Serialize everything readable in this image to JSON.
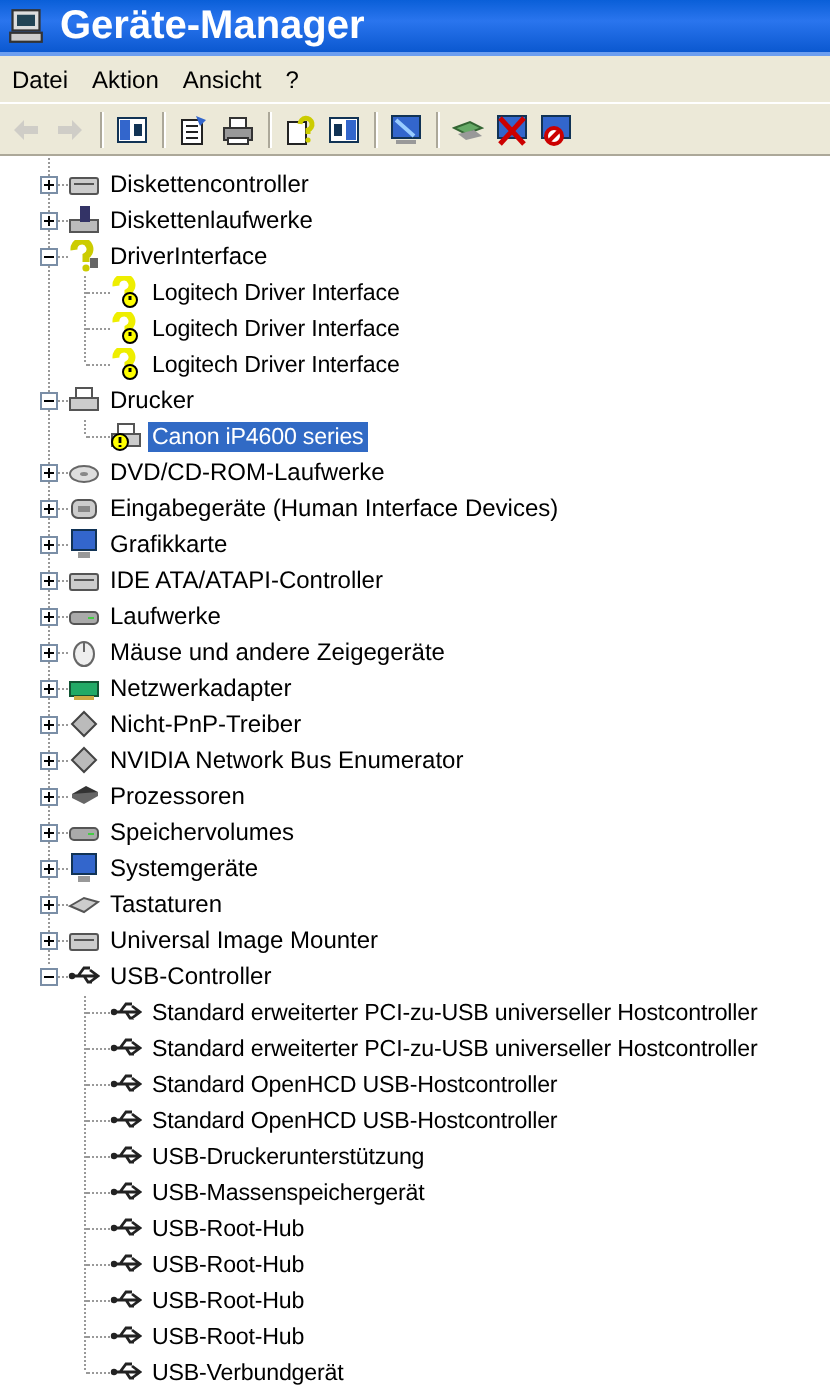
{
  "window": {
    "title": "Geräte-Manager"
  },
  "menu": [
    "Datei",
    "Aktion",
    "Ansicht",
    "?"
  ],
  "toolbar": [
    {
      "kind": "back",
      "disabled": true
    },
    {
      "kind": "forward",
      "disabled": true
    },
    {
      "kind": "sep"
    },
    {
      "kind": "tree-toggle",
      "disabled": false
    },
    {
      "kind": "sep"
    },
    {
      "kind": "properties",
      "disabled": false
    },
    {
      "kind": "print",
      "disabled": false
    },
    {
      "kind": "sep"
    },
    {
      "kind": "help",
      "disabled": false
    },
    {
      "kind": "pane-toggle",
      "disabled": false
    },
    {
      "kind": "sep"
    },
    {
      "kind": "scan",
      "disabled": false
    },
    {
      "kind": "sep"
    },
    {
      "kind": "update",
      "disabled": false
    },
    {
      "kind": "uninstall",
      "disabled": false
    },
    {
      "kind": "disable",
      "disabled": false
    }
  ],
  "tree": [
    {
      "label": "Diskettencontroller",
      "kind": "drive",
      "expanded": false,
      "selected": false
    },
    {
      "label": "Diskettenlaufwerke",
      "kind": "floppy",
      "expanded": false,
      "selected": false
    },
    {
      "label": "DriverInterface",
      "kind": "unknown",
      "expanded": true,
      "selected": false,
      "children": [
        {
          "label": "Logitech Driver Interface",
          "kind": "problem",
          "selected": false
        },
        {
          "label": "Logitech Driver Interface",
          "kind": "problem",
          "selected": false
        },
        {
          "label": "Logitech Driver Interface",
          "kind": "problem",
          "selected": false
        }
      ]
    },
    {
      "label": "Drucker",
      "kind": "printer",
      "expanded": true,
      "selected": false,
      "children": [
        {
          "label": "Canon iP4600 series",
          "kind": "printer-problem",
          "selected": true
        }
      ]
    },
    {
      "label": "DVD/CD-ROM-Laufwerke",
      "kind": "disc",
      "expanded": false,
      "selected": false
    },
    {
      "label": "Eingabegeräte (Human Interface Devices)",
      "kind": "hid",
      "expanded": false,
      "selected": false
    },
    {
      "label": "Grafikkarte",
      "kind": "display",
      "expanded": false,
      "selected": false
    },
    {
      "label": "IDE ATA/ATAPI-Controller",
      "kind": "drive",
      "expanded": false,
      "selected": false
    },
    {
      "label": "Laufwerke",
      "kind": "disk",
      "expanded": false,
      "selected": false
    },
    {
      "label": "Mäuse und andere Zeigegeräte",
      "kind": "mouse",
      "expanded": false,
      "selected": false
    },
    {
      "label": "Netzwerkadapter",
      "kind": "network",
      "expanded": false,
      "selected": false
    },
    {
      "label": "Nicht-PnP-Treiber",
      "kind": "diamond",
      "expanded": false,
      "selected": false
    },
    {
      "label": "NVIDIA Network Bus Enumerator",
      "kind": "diamond",
      "expanded": false,
      "selected": false
    },
    {
      "label": "Prozessoren",
      "kind": "chip",
      "expanded": false,
      "selected": false
    },
    {
      "label": "Speichervolumes",
      "kind": "disk",
      "expanded": false,
      "selected": false
    },
    {
      "label": "Systemgeräte",
      "kind": "display",
      "expanded": false,
      "selected": false
    },
    {
      "label": "Tastaturen",
      "kind": "keyboard",
      "expanded": false,
      "selected": false
    },
    {
      "label": "Universal Image Mounter",
      "kind": "drive",
      "expanded": false,
      "selected": false
    },
    {
      "label": "USB-Controller",
      "kind": "usb",
      "expanded": true,
      "selected": false,
      "children": [
        {
          "label": "Standard erweiterter PCI-zu-USB universeller Hostcontroller",
          "kind": "usb",
          "selected": false
        },
        {
          "label": "Standard erweiterter PCI-zu-USB universeller Hostcontroller",
          "kind": "usb",
          "selected": false
        },
        {
          "label": "Standard OpenHCD USB-Hostcontroller",
          "kind": "usb",
          "selected": false
        },
        {
          "label": "Standard OpenHCD USB-Hostcontroller",
          "kind": "usb",
          "selected": false
        },
        {
          "label": "USB-Druckerunterstützung",
          "kind": "usb",
          "selected": false
        },
        {
          "label": "USB-Massenspeichergerät",
          "kind": "usb",
          "selected": false
        },
        {
          "label": "USB-Root-Hub",
          "kind": "usb",
          "selected": false
        },
        {
          "label": "USB-Root-Hub",
          "kind": "usb",
          "selected": false
        },
        {
          "label": "USB-Root-Hub",
          "kind": "usb",
          "selected": false
        },
        {
          "label": "USB-Root-Hub",
          "kind": "usb",
          "selected": false
        },
        {
          "label": "USB-Verbundgerät",
          "kind": "usb",
          "selected": false
        }
      ]
    }
  ]
}
